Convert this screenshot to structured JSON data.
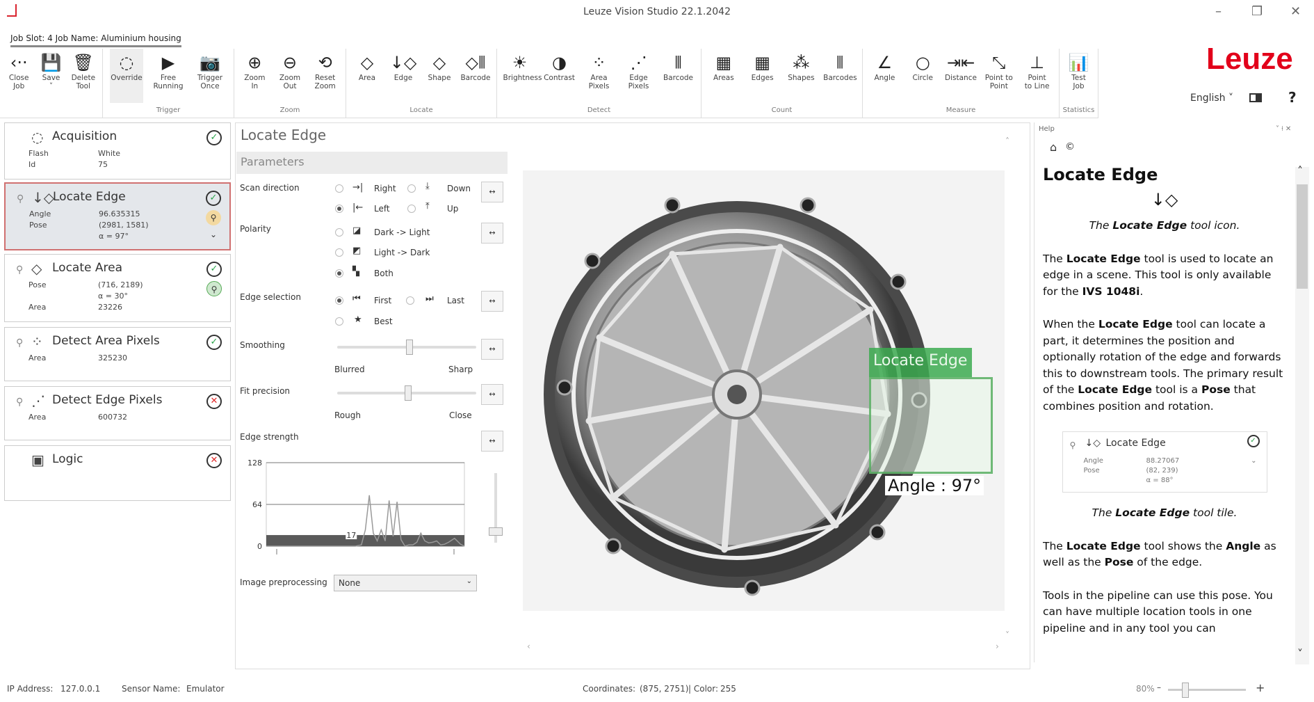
{
  "window": {
    "title": "Leuze Vision Studio 22.1.2042",
    "minimize": "–",
    "restore": "❐",
    "close": "✕"
  },
  "job": {
    "label": "Job Slot: 4 Job Name: Aluminium housing"
  },
  "ribbon": {
    "groups": [
      {
        "label": "",
        "width": 148,
        "items": [
          {
            "id": "close-job",
            "label": "Close\nJob",
            "icon": "‹··"
          },
          {
            "id": "save",
            "label": "Save\n˅",
            "icon": "💾"
          },
          {
            "id": "delete-tool",
            "label": "Delete\nTool",
            "icon": "🗑"
          }
        ]
      },
      {
        "label": "Trigger",
        "width": 189,
        "items": [
          {
            "id": "override",
            "label": "Override",
            "icon": "◌",
            "active": true
          },
          {
            "id": "free-running",
            "label": "Free\nRunning",
            "icon": "▶"
          },
          {
            "id": "trigger-once",
            "label": "Trigger\nOnce",
            "icon": "📷"
          }
        ]
      },
      {
        "label": "Zoom",
        "width": 161,
        "items": [
          {
            "id": "zoom-in",
            "label": "Zoom\nIn",
            "icon": "⊕"
          },
          {
            "id": "zoom-out",
            "label": "Zoom\nOut",
            "icon": "⊖"
          },
          {
            "id": "reset-zoom",
            "label": "Reset\nZoom",
            "icon": "⟲"
          }
        ]
      },
      {
        "label": "Locate",
        "width": 217,
        "items": [
          {
            "id": "locate-area",
            "label": "Area",
            "icon": "◇"
          },
          {
            "id": "locate-edge",
            "label": "Edge",
            "icon": "↓◇"
          },
          {
            "id": "locate-shape",
            "label": "Shape",
            "icon": "◇"
          },
          {
            "id": "locate-barcode",
            "label": "Barcode",
            "icon": "◇⦀"
          }
        ]
      },
      {
        "label": "Detect",
        "width": 294,
        "items": [
          {
            "id": "brightness",
            "label": "Brightness",
            "icon": "☀"
          },
          {
            "id": "contrast",
            "label": "Contrast",
            "icon": "◑"
          },
          {
            "id": "area-pixels",
            "label": "Area\nPixels",
            "icon": "⁘"
          },
          {
            "id": "edge-pixels",
            "label": "Edge\nPixels",
            "icon": "⋰"
          },
          {
            "id": "detect-barcode",
            "label": "Barcode",
            "icon": "⦀"
          }
        ]
      },
      {
        "label": "Count",
        "width": 232,
        "items": [
          {
            "id": "count-areas",
            "label": "Areas",
            "icon": "▦"
          },
          {
            "id": "count-edges",
            "label": "Edges",
            "icon": "▦"
          },
          {
            "id": "count-shapes",
            "label": "Shapes",
            "icon": "⁂"
          },
          {
            "id": "count-barcodes",
            "label": "Barcodes",
            "icon": "⦀"
          }
        ]
      },
      {
        "label": "Measure",
        "width": 283,
        "items": [
          {
            "id": "angle",
            "label": "Angle",
            "icon": "∠"
          },
          {
            "id": "circle",
            "label": "Circle",
            "icon": "○"
          },
          {
            "id": "distance",
            "label": "Distance",
            "icon": "⇥⇤"
          },
          {
            "id": "point-to-point",
            "label": "Point to\nPoint",
            "icon": "⤡"
          },
          {
            "id": "point-to-line",
            "label": "Point\nto Line",
            "icon": "⊥"
          }
        ]
      },
      {
        "label": "Statistics",
        "width": 56,
        "items": [
          {
            "id": "test-job",
            "label": "Test\nJob",
            "icon": "📊"
          }
        ]
      }
    ]
  },
  "brand": "Leuze",
  "language": "English ˅",
  "help_button": "?",
  "pipeline": [
    {
      "name": "Acquisition",
      "icon": "◌",
      "status": "ok",
      "rows": [
        [
          "Flash",
          "White"
        ],
        [
          "Id",
          "75"
        ]
      ]
    },
    {
      "name": "Locate Edge",
      "icon": "↓◇",
      "status": "ok",
      "pin": true,
      "selected": true,
      "rows": [
        [
          "Angle",
          "96.635315"
        ],
        [
          "Pose",
          "(2981, 1581)"
        ],
        [
          "",
          "α = 97°"
        ]
      ]
    },
    {
      "name": "Locate Area",
      "icon": "◇",
      "status": "ok",
      "pin": true,
      "rows": [
        [
          "Pose",
          "(716, 2189)"
        ],
        [
          "",
          "α = 30°"
        ],
        [
          "Area",
          "23226"
        ]
      ]
    },
    {
      "name": "Detect Area Pixels",
      "icon": "⁘",
      "status": "ok",
      "pin": true,
      "rows": [
        [
          "Area",
          "325230"
        ]
      ]
    },
    {
      "name": "Detect Edge Pixels",
      "icon": "⋰",
      "status": "error",
      "pin": true,
      "rows": [
        [
          "Area",
          "600732"
        ]
      ]
    },
    {
      "name": "Logic",
      "icon": "▣",
      "status": "error",
      "rows": []
    }
  ],
  "tool": {
    "title": "Locate Edge",
    "section": "Parameters",
    "scan_direction": {
      "label": "Scan direction",
      "options": [
        "Right",
        "Down",
        "Left",
        "Up"
      ],
      "selected": "Left"
    },
    "polarity": {
      "label": "Polarity",
      "options": [
        "Dark -> Light",
        "Light -> Dark",
        "Both"
      ],
      "selected": "Both"
    },
    "edge_selection": {
      "label": "Edge selection",
      "options": [
        "First",
        "Last",
        "Best"
      ],
      "selected": "First"
    },
    "smoothing": {
      "label": "Smoothing",
      "min_label": "Blurred",
      "max_label": "Sharp",
      "value": 0.52
    },
    "fit_precision": {
      "label": "Fit precision",
      "min_label": "Rough",
      "max_label": "Close",
      "value": 0.51
    },
    "edge_strength": {
      "label": "Edge strength"
    },
    "image_preprocessing": {
      "label": "Image preprocessing",
      "value": "None"
    },
    "reset_icon": "↔"
  },
  "chart_data": {
    "type": "line",
    "title": "Edge strength",
    "ylim": [
      0,
      128
    ],
    "yticks": [
      "128",
      "64",
      "0"
    ],
    "threshold": 17,
    "threshold_label": "17",
    "x": [
      0,
      5,
      10,
      15,
      20,
      25,
      30,
      35,
      40,
      45,
      48,
      50,
      52,
      54,
      56,
      58,
      60,
      62,
      64,
      66,
      68,
      70,
      72,
      74,
      76,
      78,
      80,
      82,
      84,
      86,
      88,
      90,
      92,
      95,
      98,
      100
    ],
    "values": [
      0,
      0,
      0,
      0,
      0,
      0,
      0,
      0,
      0,
      0,
      2,
      25,
      78,
      20,
      8,
      25,
      8,
      70,
      15,
      68,
      10,
      0,
      2,
      2,
      6,
      20,
      8,
      5,
      6,
      8,
      2,
      3,
      6,
      12,
      3,
      0
    ]
  },
  "overlay": {
    "label": "Locate Edge",
    "angle": "Angle : 97°"
  },
  "help": {
    "panel_title": "Help",
    "home_icon": "⌂",
    "copyright_icon": "©",
    "title": "Locate Edge",
    "icon_caption": [
      {
        "t": "The "
      },
      {
        "t": "Locate Edge",
        "b": true
      },
      {
        "t": " tool icon."
      }
    ],
    "paragraphs": [
      [
        {
          "t": "The "
        },
        {
          "t": "Locate Edge",
          "b": true
        },
        {
          "t": " tool is used to locate an edge in a scene. This tool is only available for the "
        },
        {
          "t": "IVS 1048i",
          "b": true
        },
        {
          "t": "."
        }
      ],
      [
        {
          "t": "When the "
        },
        {
          "t": "Locate Edge",
          "b": true
        },
        {
          "t": " tool can locate a part, it determines the position and optionally rotation of the edge and forwards this to downstream tools. The primary result of the "
        },
        {
          "t": "Locate Edge",
          "b": true
        },
        {
          "t": " tool is a "
        },
        {
          "t": "Pose",
          "b": true
        },
        {
          "t": " that combines position and rotation."
        }
      ]
    ],
    "mini_tile": {
      "name": "Locate Edge",
      "angle_label": "Angle",
      "angle": "88.27067",
      "pose_label": "Pose",
      "pose": "(82, 239)",
      "alpha": "α = 88°"
    },
    "tile_caption": [
      {
        "t": "The "
      },
      {
        "t": "Locate Edge",
        "b": true
      },
      {
        "t": " tool tile."
      }
    ],
    "paragraphs2": [
      [
        {
          "t": "The "
        },
        {
          "t": "Locate Edge",
          "b": true
        },
        {
          "t": " tool shows the "
        },
        {
          "t": "Angle",
          "b": true
        },
        {
          "t": " as well as the "
        },
        {
          "t": "Pose",
          "b": true
        },
        {
          "t": " of the edge."
        }
      ],
      [
        {
          "t": "Tools in the pipeline can use this pose. You can have multiple location tools in one pipeline and in any tool you can"
        }
      ]
    ]
  },
  "statusbar": {
    "ip_label": "IP Address:",
    "ip": "127.0.0.1",
    "sensor_label": "Sensor Name:",
    "sensor": "Emulator",
    "coords_label": "Coordinates:",
    "coords": "(875, 2751)",
    "color_label": "| Color:",
    "color": "255",
    "zoom": "80%",
    "zoom_minus": "–",
    "zoom_plus": "+",
    "zoom_value": 0.2
  },
  "colors": {
    "brand": "#e2001a",
    "ok": "#2aa54a",
    "error": "#e12a2a",
    "overlay": "#3caa50",
    "selected_border": "#d07070"
  }
}
